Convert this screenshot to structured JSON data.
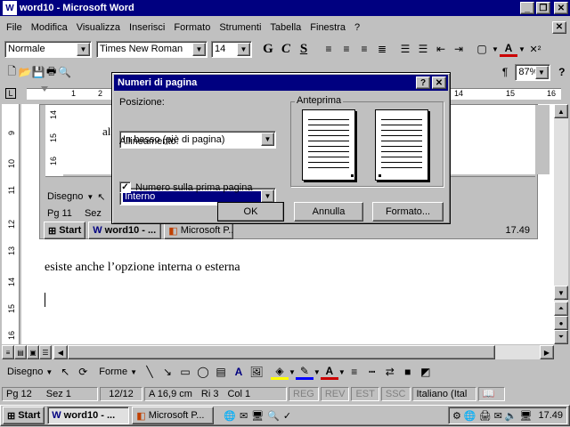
{
  "window": {
    "title": "word10 - Microsoft Word"
  },
  "menu": [
    "File",
    "Modifica",
    "Visualizza",
    "Inserisci",
    "Formato",
    "Strumenti",
    "Tabella",
    "Finestra",
    "?"
  ],
  "formatting": {
    "style": "Normale",
    "font": "Times New Roman",
    "size": "14",
    "bold": "G",
    "italic": "C",
    "underline": "S"
  },
  "standard": {
    "zoom": "87%"
  },
  "document": {
    "line1": "esiste anche l’opzione interna o esterna",
    "behind_text": "alla s",
    "behind_ruler_nums": [
      "14",
      "15",
      "16"
    ],
    "ruler_nums_right": [
      "14",
      "15",
      "16"
    ]
  },
  "inner_window": {
    "draw_label": "Disegno",
    "status": {
      "page": "Pg  11",
      "sec": "Sez"
    },
    "taskbar": {
      "start": "Start",
      "word": "word10 - ...",
      "ppt": "Microsoft P...",
      "clock": "17.49"
    }
  },
  "dialog": {
    "title": "Numeri di pagina",
    "help": "?",
    "posizione_label": "Posizione:",
    "posizione_value": "In basso (piè di pagina)",
    "allineamento_label": "Allineamento:",
    "allineamento_value": "Interno",
    "checkbox_label": "Numero sulla prima pagina",
    "anteprima_label": "Anteprima",
    "ok": "OK",
    "annulla": "Annulla",
    "formato": "Formato..."
  },
  "drawing": {
    "disegno": "Disegno",
    "forme": "Forme"
  },
  "status": {
    "page": "Pg  12",
    "sec": "Sez  1",
    "pages": "12/12",
    "pos": "A  16,9 cm",
    "row": "Ri  3",
    "col": "Col  1",
    "reg": "REG",
    "rev": "REV",
    "est": "EST",
    "ssc": "SSC",
    "lang": "Italiano (Ital"
  },
  "taskbar": {
    "start": "Start",
    "word": "word10 - ...",
    "ppt": "Microsoft P...",
    "clock": "17.49"
  },
  "vruler": [
    "9",
    "10",
    "11",
    "12",
    "13",
    "14",
    "15",
    "16"
  ],
  "hruler": [
    "1",
    "2"
  ]
}
